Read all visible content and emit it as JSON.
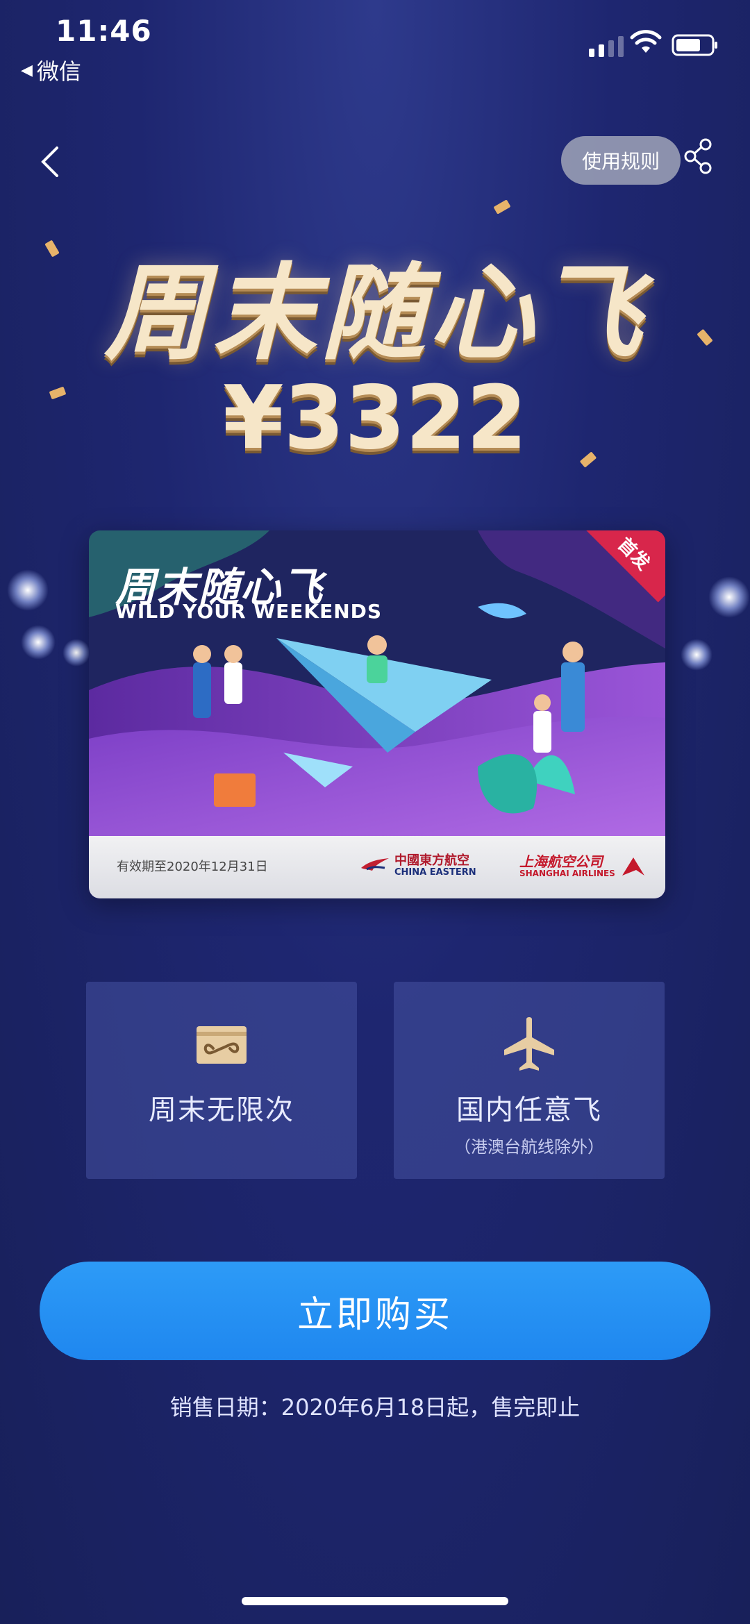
{
  "status_bar": {
    "time": "11:46",
    "back_app": "微信"
  },
  "nav": {
    "rules_label": "使用规则"
  },
  "hero": {
    "title": "周末随心飞",
    "price": "¥3322"
  },
  "card": {
    "title": "周末随心飞",
    "subtitle": "WILD YOUR WEEKENDS",
    "badge": "首发",
    "validity": "有效期至2020年12月31日",
    "china_eastern_cn": "中國東方航空",
    "china_eastern_en": "CHINA EASTERN",
    "shanghai_airlines_cn": "上海航空公司",
    "shanghai_airlines_en": "SHANGHAI AIRLINES"
  },
  "features": [
    {
      "label": "周末无限次",
      "icon": "infinity-card-icon"
    },
    {
      "label": "国内任意飞",
      "note": "（港澳台航线除外）",
      "icon": "airplane-icon"
    }
  ],
  "buy": {
    "label": "立即购买",
    "sale_date": "销售日期：2020年6月18日起，售完即止"
  },
  "colors": {
    "background": "#1e2670",
    "gold": "#f6e6c8",
    "button_blue": "#2d9bf7",
    "badge_red": "#d8264b"
  }
}
